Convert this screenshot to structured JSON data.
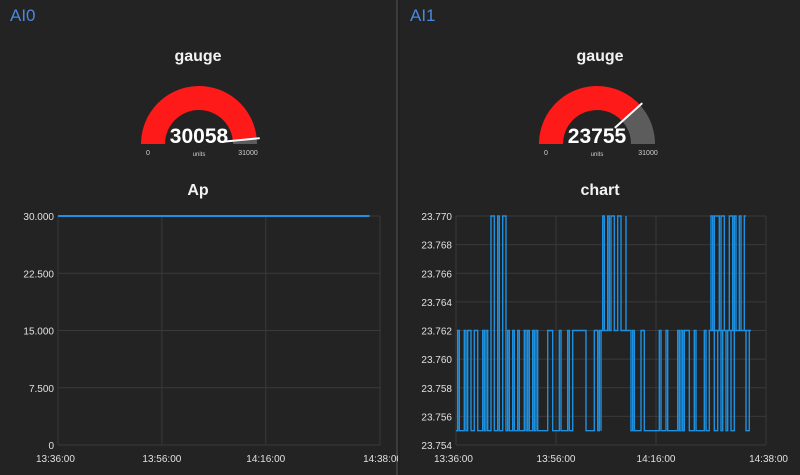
{
  "groups": [
    {
      "title": "AI0",
      "gauge": {
        "title": "gauge",
        "value": "30058",
        "units": "units",
        "min": "0",
        "max": "31000",
        "fraction": 0.9696,
        "color": "#ff1a1a",
        "track": "#5c5c5c"
      },
      "chart": {
        "title": "Ap"
      }
    },
    {
      "title": "AI1",
      "gauge": {
        "title": "gauge",
        "value": "23755",
        "units": "units",
        "min": "0",
        "max": "31000",
        "fraction": 0.7663,
        "color": "#ff1a1a",
        "track": "#5c5c5c"
      },
      "chart": {
        "title": "chart"
      }
    }
  ],
  "chart_data": [
    {
      "type": "line",
      "title": "Ap",
      "x_ticks": [
        "13:36:00",
        "13:56:00",
        "14:16:00",
        "14:38:00"
      ],
      "y_ticks": [
        "30.000",
        "22.500",
        "15.000",
        "7.500",
        "0"
      ],
      "ylim": [
        0,
        30
      ],
      "xlim": [
        "13:36:00",
        "14:38:00"
      ],
      "grid": true,
      "line_color": "#1e90e0",
      "series": [
        {
          "x": [
            "13:36:00",
            "14:36:00"
          ],
          "y": [
            30.0,
            30.0
          ]
        }
      ]
    },
    {
      "type": "line",
      "title": "chart",
      "x_ticks": [
        "13:36:00",
        "13:56:00",
        "14:16:00",
        "14:38:00"
      ],
      "y_ticks": [
        "23.770",
        "23.768",
        "23.766",
        "23.764",
        "23.762",
        "23.760",
        "23.758",
        "23.756",
        "23.754"
      ],
      "ylim": [
        23.754,
        23.77
      ],
      "xlim": [
        "13:36:00",
        "14:38:00"
      ],
      "grid": true,
      "line_color": "#1e90e0",
      "series": [
        {
          "pattern": "rapid switching between levels",
          "levels": [
            23.755,
            23.762,
            23.77
          ],
          "segments": [
            {
              "from": "13:36:00",
              "to": "13:43:00",
              "low": 23.755,
              "high": 23.762
            },
            {
              "from": "13:43:00",
              "to": "13:46:00",
              "low": 23.755,
              "high": 23.77
            },
            {
              "from": "13:46:00",
              "to": "13:52:00",
              "low": 23.755,
              "high": 23.762
            },
            {
              "from": "13:52:00",
              "to": "14:05:00",
              "low": 23.755,
              "high": 23.762
            },
            {
              "from": "14:05:00",
              "to": "14:10:00",
              "low": 23.762,
              "high": 23.77
            },
            {
              "from": "14:10:00",
              "to": "14:13:00",
              "low": 23.755,
              "high": 23.762
            },
            {
              "from": "14:13:00",
              "to": "14:35:00",
              "low": 23.755,
              "high": 23.762
            },
            {
              "from": "14:27:00",
              "to": "14:34:00",
              "low": 23.762,
              "high": 23.77
            }
          ]
        }
      ]
    }
  ]
}
